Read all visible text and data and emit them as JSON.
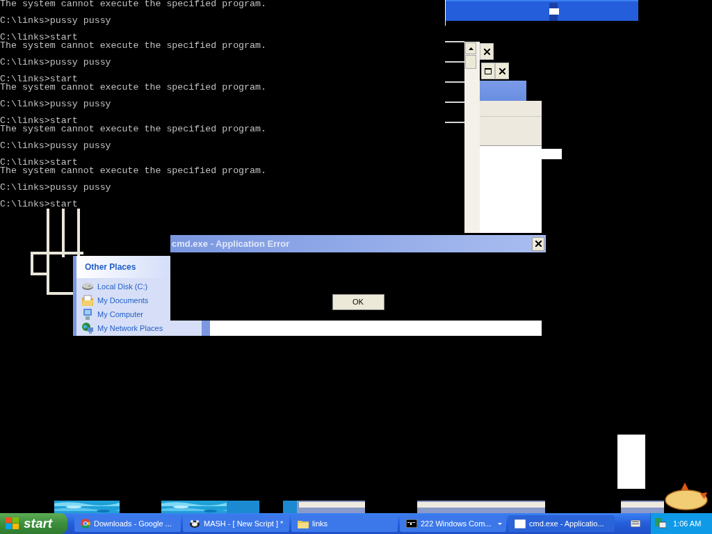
{
  "console": {
    "blocks": [
      [
        "The system cannot execute the specified program."
      ],
      [
        "C:\\links>pussy pussy"
      ],
      [
        "C:\\links>start",
        "The system cannot execute the specified program."
      ],
      [
        "C:\\links>pussy pussy"
      ],
      [
        "C:\\links>start",
        "The system cannot execute the specified program."
      ],
      [
        "C:\\links>pussy pussy"
      ],
      [
        "C:\\links>start",
        "The system cannot execute the specified program."
      ],
      [
        "C:\\links>pussy pussy"
      ],
      [
        "C:\\links>start",
        "The system cannot execute the specified program."
      ],
      [
        "C:\\links>pussy pussy"
      ],
      [
        "C:\\links>start"
      ]
    ]
  },
  "other_places": {
    "title": "Other Places",
    "items": [
      {
        "label": "Local Disk (C:)",
        "kind": "drive"
      },
      {
        "label": "My Documents",
        "kind": "documents"
      },
      {
        "label": "My Computer",
        "kind": "computer"
      },
      {
        "label": "My Network Places",
        "kind": "network"
      }
    ]
  },
  "dialog": {
    "title": "cmd.exe - Application Error",
    "button": "OK"
  },
  "taskbar": {
    "start": "start",
    "tasks": [
      {
        "label": "Downloads - Google ...",
        "kind": "browser",
        "grouped": false,
        "selected": false
      },
      {
        "label": "MASH - [ New Script ] *",
        "kind": "script",
        "grouped": false,
        "selected": false
      },
      {
        "label": "links",
        "kind": "folder",
        "grouped": false,
        "selected": false
      },
      {
        "label": "222 Windows Com...",
        "kind": "console",
        "grouped": true,
        "selected": false
      },
      {
        "label": "cmd.exe - Applicatio...",
        "kind": "window",
        "grouped": false,
        "selected": true
      }
    ],
    "clock": "1:06 AM"
  }
}
